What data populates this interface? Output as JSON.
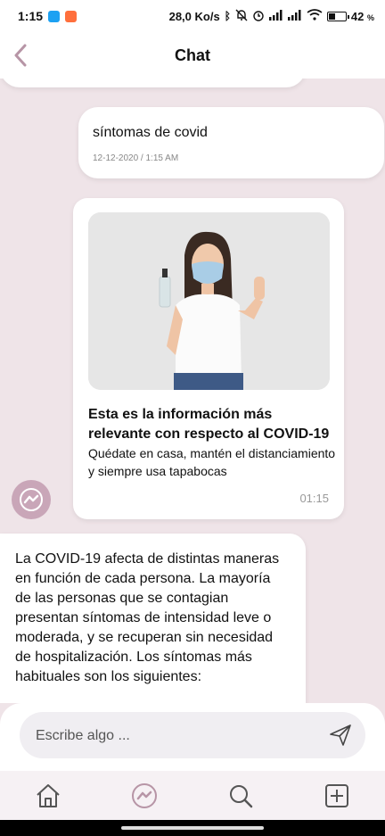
{
  "status_bar": {
    "time": "1:15",
    "net_speed": "28,0 Ko/s",
    "battery_pct": "42",
    "battery_pct_symbol": "%",
    "battery_level": 0.42,
    "app_icons": [
      "twitter-icon",
      "notification-app-icon"
    ],
    "status_icons": [
      "bluetooth-icon",
      "mute-icon",
      "alarm-icon",
      "signal-icon",
      "signal-icon",
      "wifi-icon",
      "battery-icon"
    ]
  },
  "header": {
    "title": "Chat",
    "back_icon": "chevron-left-icon"
  },
  "messages": {
    "user": {
      "text": "síntomas de covid",
      "time": "12-12-2020 / 1:15 AM"
    },
    "card": {
      "title": "Esta es la información más relevante con respecto al COVID-19",
      "body": "Quédate en casa, mantén el distanciamiento y siempre usa tapabocas",
      "time": "01:15"
    },
    "bot_long": "La COVID-19 afecta de distintas maneras en función de cada persona. La mayoría de las personas que se contagian presentan síntomas de intensidad leve o moderada, y se recuperan sin necesidad de hospitalización. Los síntomas más habituales son los siguientes:"
  },
  "input": {
    "placeholder": "Escribe algo ...",
    "value": ""
  },
  "nav": {
    "items": [
      "home-icon",
      "chat-icon",
      "search-icon",
      "add-icon"
    ],
    "active": "chat-icon"
  },
  "colors": {
    "accent": "#c9a6b8",
    "background": "#efe4e8"
  }
}
